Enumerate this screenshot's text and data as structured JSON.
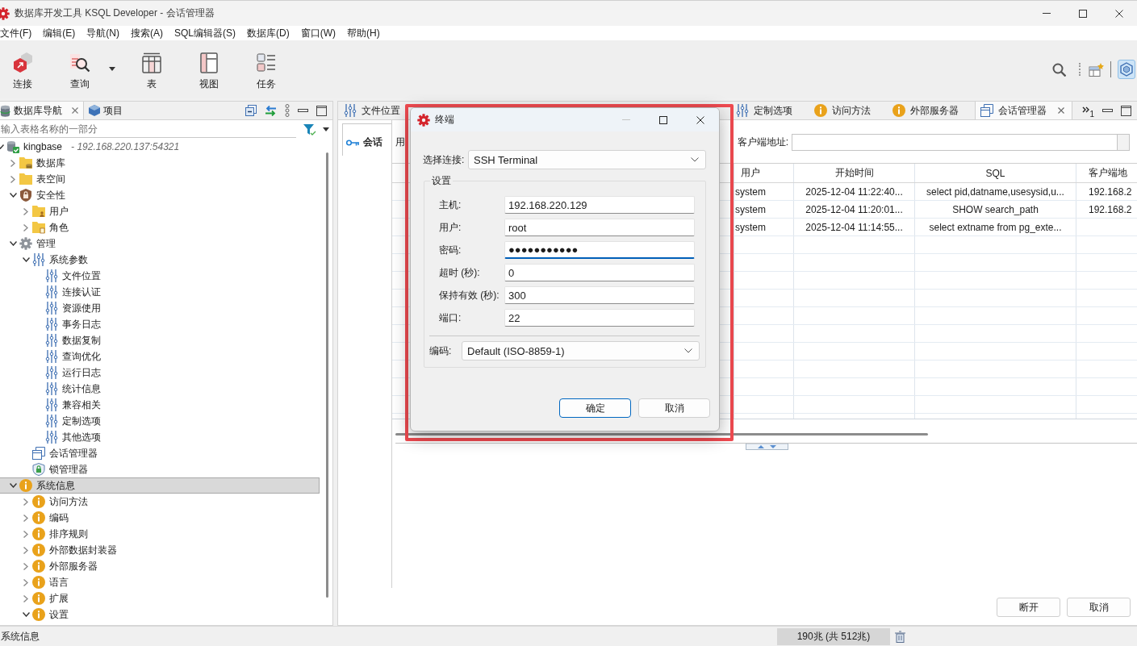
{
  "window": {
    "title": "数据库开发工具 KSQL Developer - 会话管理器"
  },
  "menu": [
    {
      "label": "文件(F)"
    },
    {
      "label": "编辑(E)"
    },
    {
      "label": "导航(N)"
    },
    {
      "label": "搜索(A)"
    },
    {
      "label": "SQL编辑器(S)"
    },
    {
      "label": "数据库(D)"
    },
    {
      "label": "窗口(W)"
    },
    {
      "label": "帮助(H)"
    }
  ],
  "toolbar": {
    "buttons": [
      {
        "label": "连接",
        "dropdown": false
      },
      {
        "label": "查询",
        "dropdown": true
      },
      {
        "label": "表",
        "dropdown": false
      },
      {
        "label": "视图",
        "dropdown": false
      },
      {
        "label": "任务",
        "dropdown": false
      }
    ]
  },
  "navigator": {
    "tabs": [
      {
        "label": "数据库导航",
        "selected": true
      },
      {
        "label": "项目",
        "selected": false
      }
    ],
    "filter": {
      "placeholder": "输入表格名称的一部分"
    },
    "tree": [
      {
        "label": "kingbase",
        "detail": "- 192.168.220.137:54321",
        "kind": "connection",
        "expanded": true,
        "selected": false,
        "children": [
          {
            "label": "数据库",
            "kind": "database-folder",
            "expanded": false,
            "selected": false
          },
          {
            "label": "表空间",
            "kind": "folder",
            "expanded": false,
            "selected": false
          },
          {
            "label": "安全性",
            "kind": "security",
            "expanded": true,
            "selected": false,
            "children": [
              {
                "label": "用户",
                "kind": "user-folder",
                "expanded": false,
                "selected": false
              },
              {
                "label": "角色",
                "kind": "role-folder",
                "expanded": false,
                "selected": false
              }
            ]
          },
          {
            "label": "管理",
            "kind": "admin",
            "expanded": true,
            "selected": false,
            "children": [
              {
                "label": "系统参数",
                "kind": "parameters",
                "expanded": true,
                "selected": false,
                "children": [
                  {
                    "label": "文件位置",
                    "kind": "parameters",
                    "selected": false
                  },
                  {
                    "label": "连接认证",
                    "kind": "parameters",
                    "selected": false
                  },
                  {
                    "label": "资源使用",
                    "kind": "parameters",
                    "selected": false
                  },
                  {
                    "label": "事务日志",
                    "kind": "parameters",
                    "selected": false
                  },
                  {
                    "label": "数据复制",
                    "kind": "parameters",
                    "selected": false
                  },
                  {
                    "label": "查询优化",
                    "kind": "parameters",
                    "selected": false
                  },
                  {
                    "label": "运行日志",
                    "kind": "parameters",
                    "selected": false
                  },
                  {
                    "label": "统计信息",
                    "kind": "parameters",
                    "selected": false
                  },
                  {
                    "label": "兼容相关",
                    "kind": "parameters",
                    "selected": false
                  },
                  {
                    "label": "定制选项",
                    "kind": "parameters",
                    "selected": false
                  },
                  {
                    "label": "其他选项",
                    "kind": "parameters",
                    "selected": false
                  }
                ]
              },
              {
                "label": "会话管理器",
                "kind": "sessions",
                "selected": false
              },
              {
                "label": "锁管理器",
                "kind": "locks",
                "selected": false
              }
            ]
          },
          {
            "label": "系统信息",
            "kind": "info",
            "expanded": true,
            "selected": true,
            "children": [
              {
                "label": "访问方法",
                "kind": "info",
                "expanded": false,
                "selected": false
              },
              {
                "label": "编码",
                "kind": "info",
                "expanded": false,
                "selected": false
              },
              {
                "label": "排序规则",
                "kind": "info",
                "expanded": false,
                "selected": false
              },
              {
                "label": "外部数据封装器",
                "kind": "info",
                "expanded": false,
                "selected": false
              },
              {
                "label": "外部服务器",
                "kind": "info",
                "expanded": false,
                "selected": false
              },
              {
                "label": "语言",
                "kind": "info",
                "expanded": false,
                "selected": false
              },
              {
                "label": "扩展",
                "kind": "info",
                "expanded": false,
                "selected": false
              },
              {
                "label": "设置",
                "kind": "info",
                "expanded": true,
                "selected": false
              }
            ]
          }
        ]
      }
    ]
  },
  "editor": {
    "tabs": [
      {
        "label": "文件位置",
        "kind": "parameters",
        "selected": false
      },
      {
        "label": "定制选项",
        "kind": "parameters",
        "selected": false
      },
      {
        "label": "访问方法",
        "kind": "info",
        "selected": false
      },
      {
        "label": "外部服务器",
        "kind": "info",
        "selected": false
      },
      {
        "label": "会话管理器",
        "kind": "sessions",
        "selected": true
      }
    ],
    "more_tabs": "1",
    "side_tabs": [
      {
        "label": "会话",
        "selected": true
      }
    ],
    "filter_labels": [
      "用",
      "客户端地址:"
    ],
    "table": {
      "columns": [
        "用户",
        "开始时间",
        "SQL",
        "客户端地"
      ],
      "rows": [
        [
          "system",
          "2025-12-04 11:22:40...",
          "select pid,datname,usesysid,u...",
          "192.168.2"
        ],
        [
          "system",
          "2025-12-04 11:20:01...",
          "SHOW search_path",
          "192.168.2"
        ],
        [
          "system",
          "2025-12-04 11:14:55...",
          "select extname from pg_exte..."
        ]
      ]
    },
    "buttons": [
      "断开",
      "取消"
    ]
  },
  "dialog": {
    "title": "终端",
    "connection": {
      "label": "选择连接:",
      "value": "SSH Terminal"
    },
    "settings": {
      "title": "设置",
      "fields": [
        {
          "label": "主机:",
          "value": "192.168.220.129",
          "focused": false
        },
        {
          "label": "用户:",
          "value": "root",
          "focused": false
        },
        {
          "label": "密码:",
          "value": "●●●●●●●●●●●",
          "focused": true
        },
        {
          "label": "超时 (秒):",
          "value": "0",
          "focused": false
        },
        {
          "label": "保持有效 (秒):",
          "value": "300",
          "focused": false
        },
        {
          "label": "端口:",
          "value": "22",
          "focused": false
        }
      ],
      "encoding": {
        "label": "编码:",
        "value": "Default (ISO-8859-1)"
      }
    },
    "buttons": [
      {
        "label": "确定",
        "default": true
      },
      {
        "label": "取消",
        "default": false
      }
    ]
  },
  "status_bar": {
    "message": "系统信息",
    "memory": "190兆 (共 512兆)"
  }
}
